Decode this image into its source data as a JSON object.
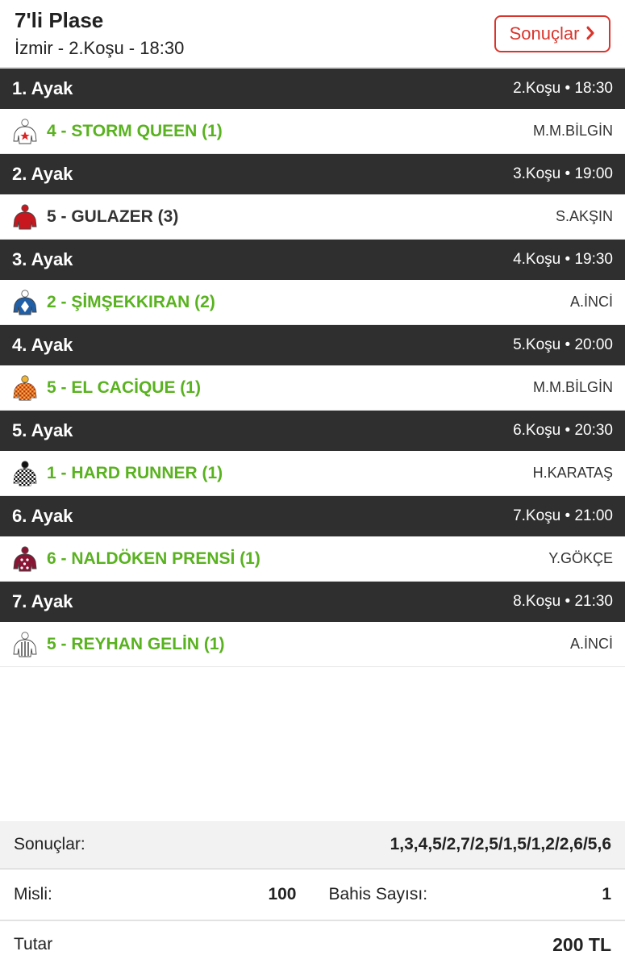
{
  "header": {
    "title": "7'li Plase",
    "subtitle": "İzmir - 2.Koşu - 18:30",
    "results_button": "Sonuçlar"
  },
  "legs": [
    {
      "name": "1. Ayak",
      "race": "2.Koşu • 18:30",
      "runner": "4 - STORM QUEEN (1)",
      "jockey": "M.M.BİLGİN",
      "silk": "white-red-star",
      "color": "green"
    },
    {
      "name": "2. Ayak",
      "race": "3.Koşu • 19:00",
      "runner": "5 - GULAZER (3)",
      "jockey": "S.AKŞIN",
      "silk": "red",
      "color": "dark"
    },
    {
      "name": "3. Ayak",
      "race": "4.Koşu • 19:30",
      "runner": "2 - ŞİMŞEKKIRAN (2)",
      "jockey": "A.İNCİ",
      "silk": "blue-white",
      "color": "green"
    },
    {
      "name": "4. Ayak",
      "race": "5.Koşu • 20:00",
      "runner": "5 - EL CACİQUE (1)",
      "jockey": "M.M.BİLGİN",
      "silk": "yellow-red-check",
      "color": "green"
    },
    {
      "name": "5. Ayak",
      "race": "6.Koşu • 20:30",
      "runner": "1 - HARD RUNNER (1)",
      "jockey": "H.KARATAŞ",
      "silk": "black-white-check",
      "color": "green"
    },
    {
      "name": "6. Ayak",
      "race": "7.Koşu • 21:00",
      "runner": "6 - NALDÖKEN PRENSİ (1)",
      "jockey": "Y.GÖKÇE",
      "silk": "maroon-dots",
      "color": "green"
    },
    {
      "name": "7. Ayak",
      "race": "8.Koşu • 21:30",
      "runner": "5 - REYHAN GELİN (1)",
      "jockey": "A.İNCİ",
      "silk": "white-gray-stripes",
      "color": "green"
    }
  ],
  "footer": {
    "results_label": "Sonuçlar:",
    "results_value": "1,3,4,5/2,7/2,5/1,5/1,2/2,6/5,6",
    "multiplier_label": "Misli:",
    "multiplier_value": "100",
    "bet_count_label": "Bahis Sayısı:",
    "bet_count_value": "1",
    "total_label": "Tutar",
    "total_value": "200 TL"
  },
  "colors": {
    "accent_red": "#d9352c",
    "winner_green": "#59b21f",
    "leg_header_bg": "#2f2f2f"
  }
}
